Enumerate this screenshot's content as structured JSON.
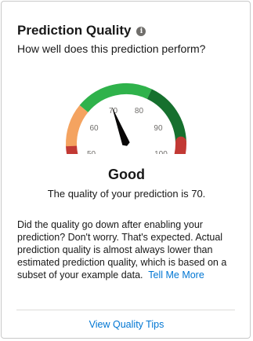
{
  "header": {
    "title": "Prediction Quality",
    "info_icon": "info-icon",
    "subtitle": "How well does this prediction perform?"
  },
  "gauge": {
    "value": 70,
    "min": 50,
    "max": 100,
    "tick_labels": [
      "50",
      "60",
      "70",
      "80",
      "90",
      "100"
    ],
    "segment_colors": {
      "red": "#c23934",
      "orange": "#f4a360",
      "light_green": "#2fb24b",
      "dark_green": "#16702e"
    },
    "needle_color": "#080707"
  },
  "result": {
    "rating": "Good",
    "quality_text": "The quality of your prediction is 70."
  },
  "explanation": {
    "text": "Did the quality go down after enabling your prediction? Don't worry. That's expected. Actual prediction quality is almost always lower than estimated prediction quality, which is based on a subset of your example data.",
    "link_label": "Tell Me More"
  },
  "footer": {
    "link_label": "View Quality Tips"
  }
}
